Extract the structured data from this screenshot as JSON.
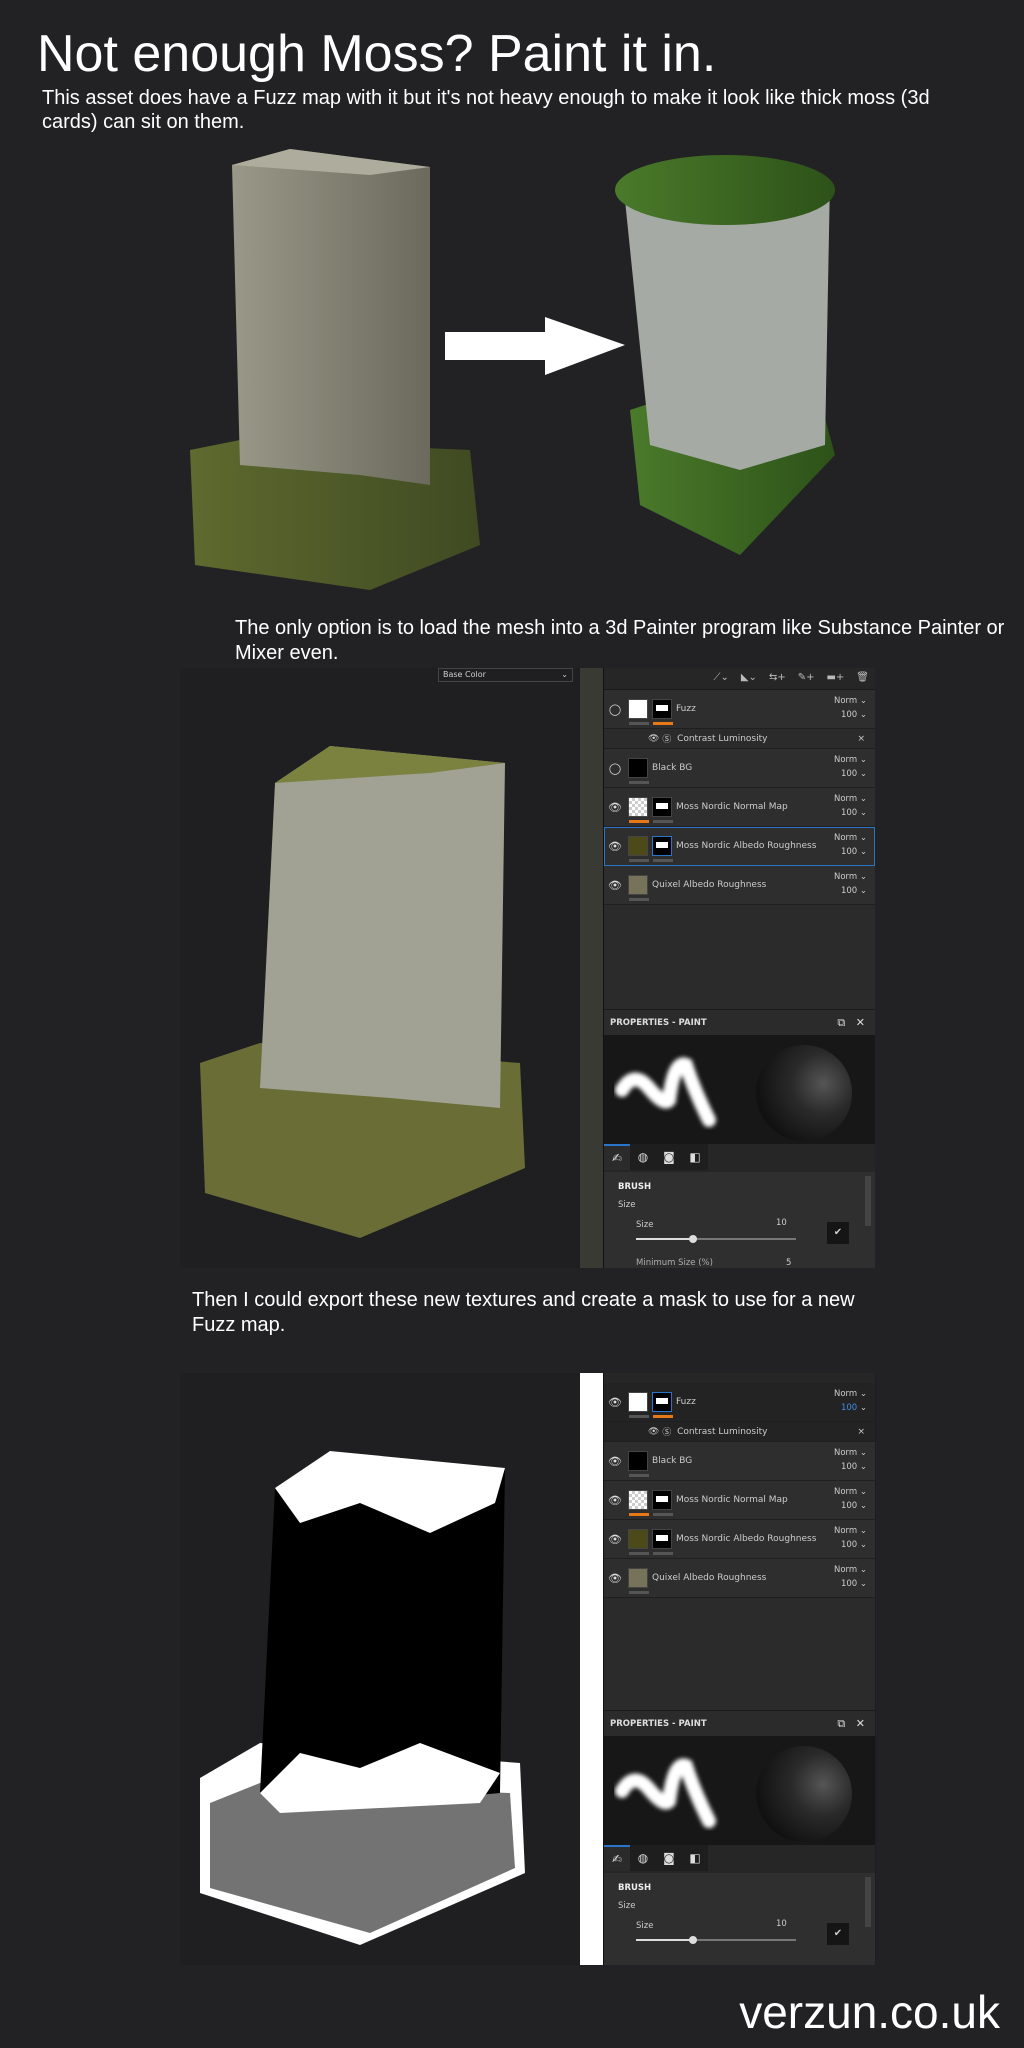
{
  "title": "Not enough Moss? Paint it in.",
  "intro": "This asset does have a Fuzz map with it but it's not heavy enough to make it look like thick moss (3d cards) can sit on them.",
  "caption_2": "The only option is to load the mesh into a 3d Painter program like Substance Painter or Mixer even.",
  "caption_3": "Then I could export these new textures and create a mask to use for a new Fuzz map.",
  "footer": "verzun.co.uk",
  "panel1": {
    "channel_dropdown": "Base Color",
    "layers": [
      {
        "name": "Fuzz",
        "blend": "Norm",
        "opacity": "100"
      },
      {
        "name": "Black BG",
        "blend": "Norm",
        "opacity": "100"
      },
      {
        "name": "Moss Nordic Normal Map",
        "blend": "Norm",
        "opacity": "100"
      },
      {
        "name": "Moss Nordic Albedo Roughness",
        "blend": "Norm",
        "opacity": "100"
      },
      {
        "name": "Quixel Albedo Roughness",
        "blend": "Norm",
        "opacity": "100"
      }
    ],
    "filter": "Contrast Luminosity"
  },
  "properties": {
    "title": "PROPERTIES - PAINT",
    "section": "BRUSH",
    "group": "Size",
    "param": "Size",
    "value": "10",
    "next_param": "Minimum Size (%)",
    "next_value": "5",
    "slider_fraction": 0.3
  },
  "colors": {
    "accent": "#2a74c9",
    "orange": "#e67818"
  }
}
